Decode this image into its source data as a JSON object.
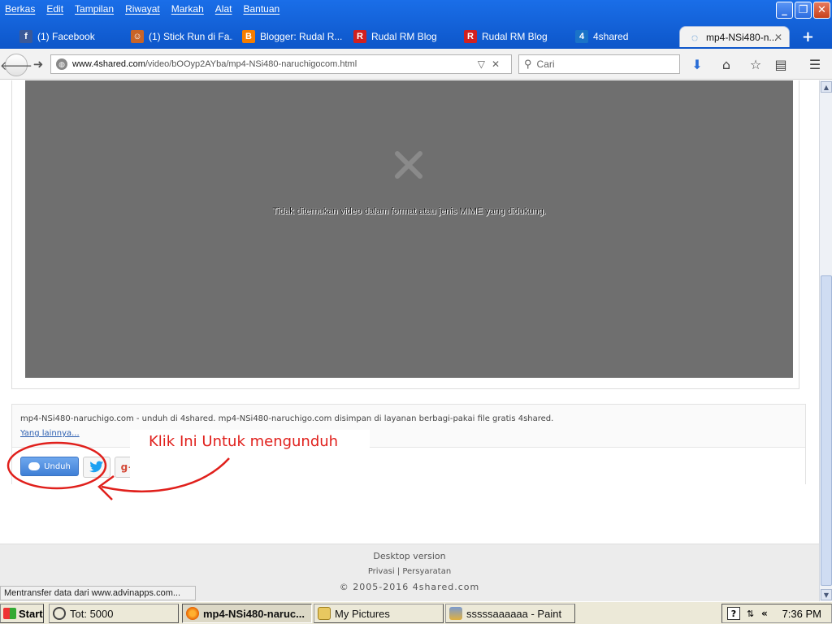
{
  "menu": [
    "Berkas",
    "Edit",
    "Tampilan",
    "Riwayat",
    "Markah",
    "Alat",
    "Bantuan"
  ],
  "tabs": [
    {
      "label": "(1) Facebook",
      "icon": "facebook-icon",
      "color": "#3b5998",
      "glyph": "f"
    },
    {
      "label": "(1) Stick Run di Fa...",
      "icon": "stick-run-icon",
      "color": "#c86428",
      "glyph": "🏃"
    },
    {
      "label": "Blogger: Rudal R...",
      "icon": "blogger-icon",
      "color": "#f57d00",
      "glyph": "B"
    },
    {
      "label": "Rudal RM Blog",
      "icon": "rudal-blog-icon",
      "color": "#d02020",
      "glyph": "R"
    },
    {
      "label": "Rudal RM Blog",
      "icon": "rudal-blog-icon",
      "color": "#d02020",
      "glyph": "R"
    },
    {
      "label": "4shared",
      "icon": "4shared-icon",
      "color": "#1a73c8",
      "glyph": "4"
    },
    {
      "label": "mp4-NSi480-n...",
      "icon": "loading-icon",
      "color": "#1a73c8",
      "glyph": "◌"
    }
  ],
  "nav": {
    "url_host": "www.4shared.com",
    "url_path": "/video/bOOyp2AYba/mp4-NSi480-naruchigocom.html",
    "search_placeholder": "Cari"
  },
  "video": {
    "message": "Tidak ditemukan video dalam format atau jenis MIME yang didukung."
  },
  "content": {
    "description": "mp4-NSi480-naruchigo.com - unduh di 4shared. mp4-NSi480-naruchigo.com disimpan di layanan berbagi-pakai file gratis 4shared.",
    "more_link": "Yang lainnya...",
    "download_label": "Unduh",
    "twitter_glyph": "🐦",
    "gplus_glyph": "g+",
    "annotation": "Klik Ini Untuk mengunduh"
  },
  "footer": {
    "desktop": "Desktop version",
    "privacy": "Privasi",
    "separator": "|",
    "terms": "Persyaratan",
    "copyright": "© 2005-2016 4shared.com"
  },
  "status": "Mentransfer data dari www.advinapps.com...",
  "taskbar": {
    "start": "Start",
    "items": [
      {
        "label": "Tot: 5000",
        "icon": "clock-icon",
        "color": "#666"
      },
      {
        "label": "mp4-NSi480-naruc...",
        "icon": "firefox-icon",
        "color": "#e66000"
      },
      {
        "label": "My Pictures",
        "icon": "folder-icon",
        "color": "#e8c860"
      },
      {
        "label": "sssssaaaaaa - Paint",
        "icon": "paint-icon",
        "color": "#7a9ad0"
      }
    ],
    "clock": "7:36 PM"
  }
}
